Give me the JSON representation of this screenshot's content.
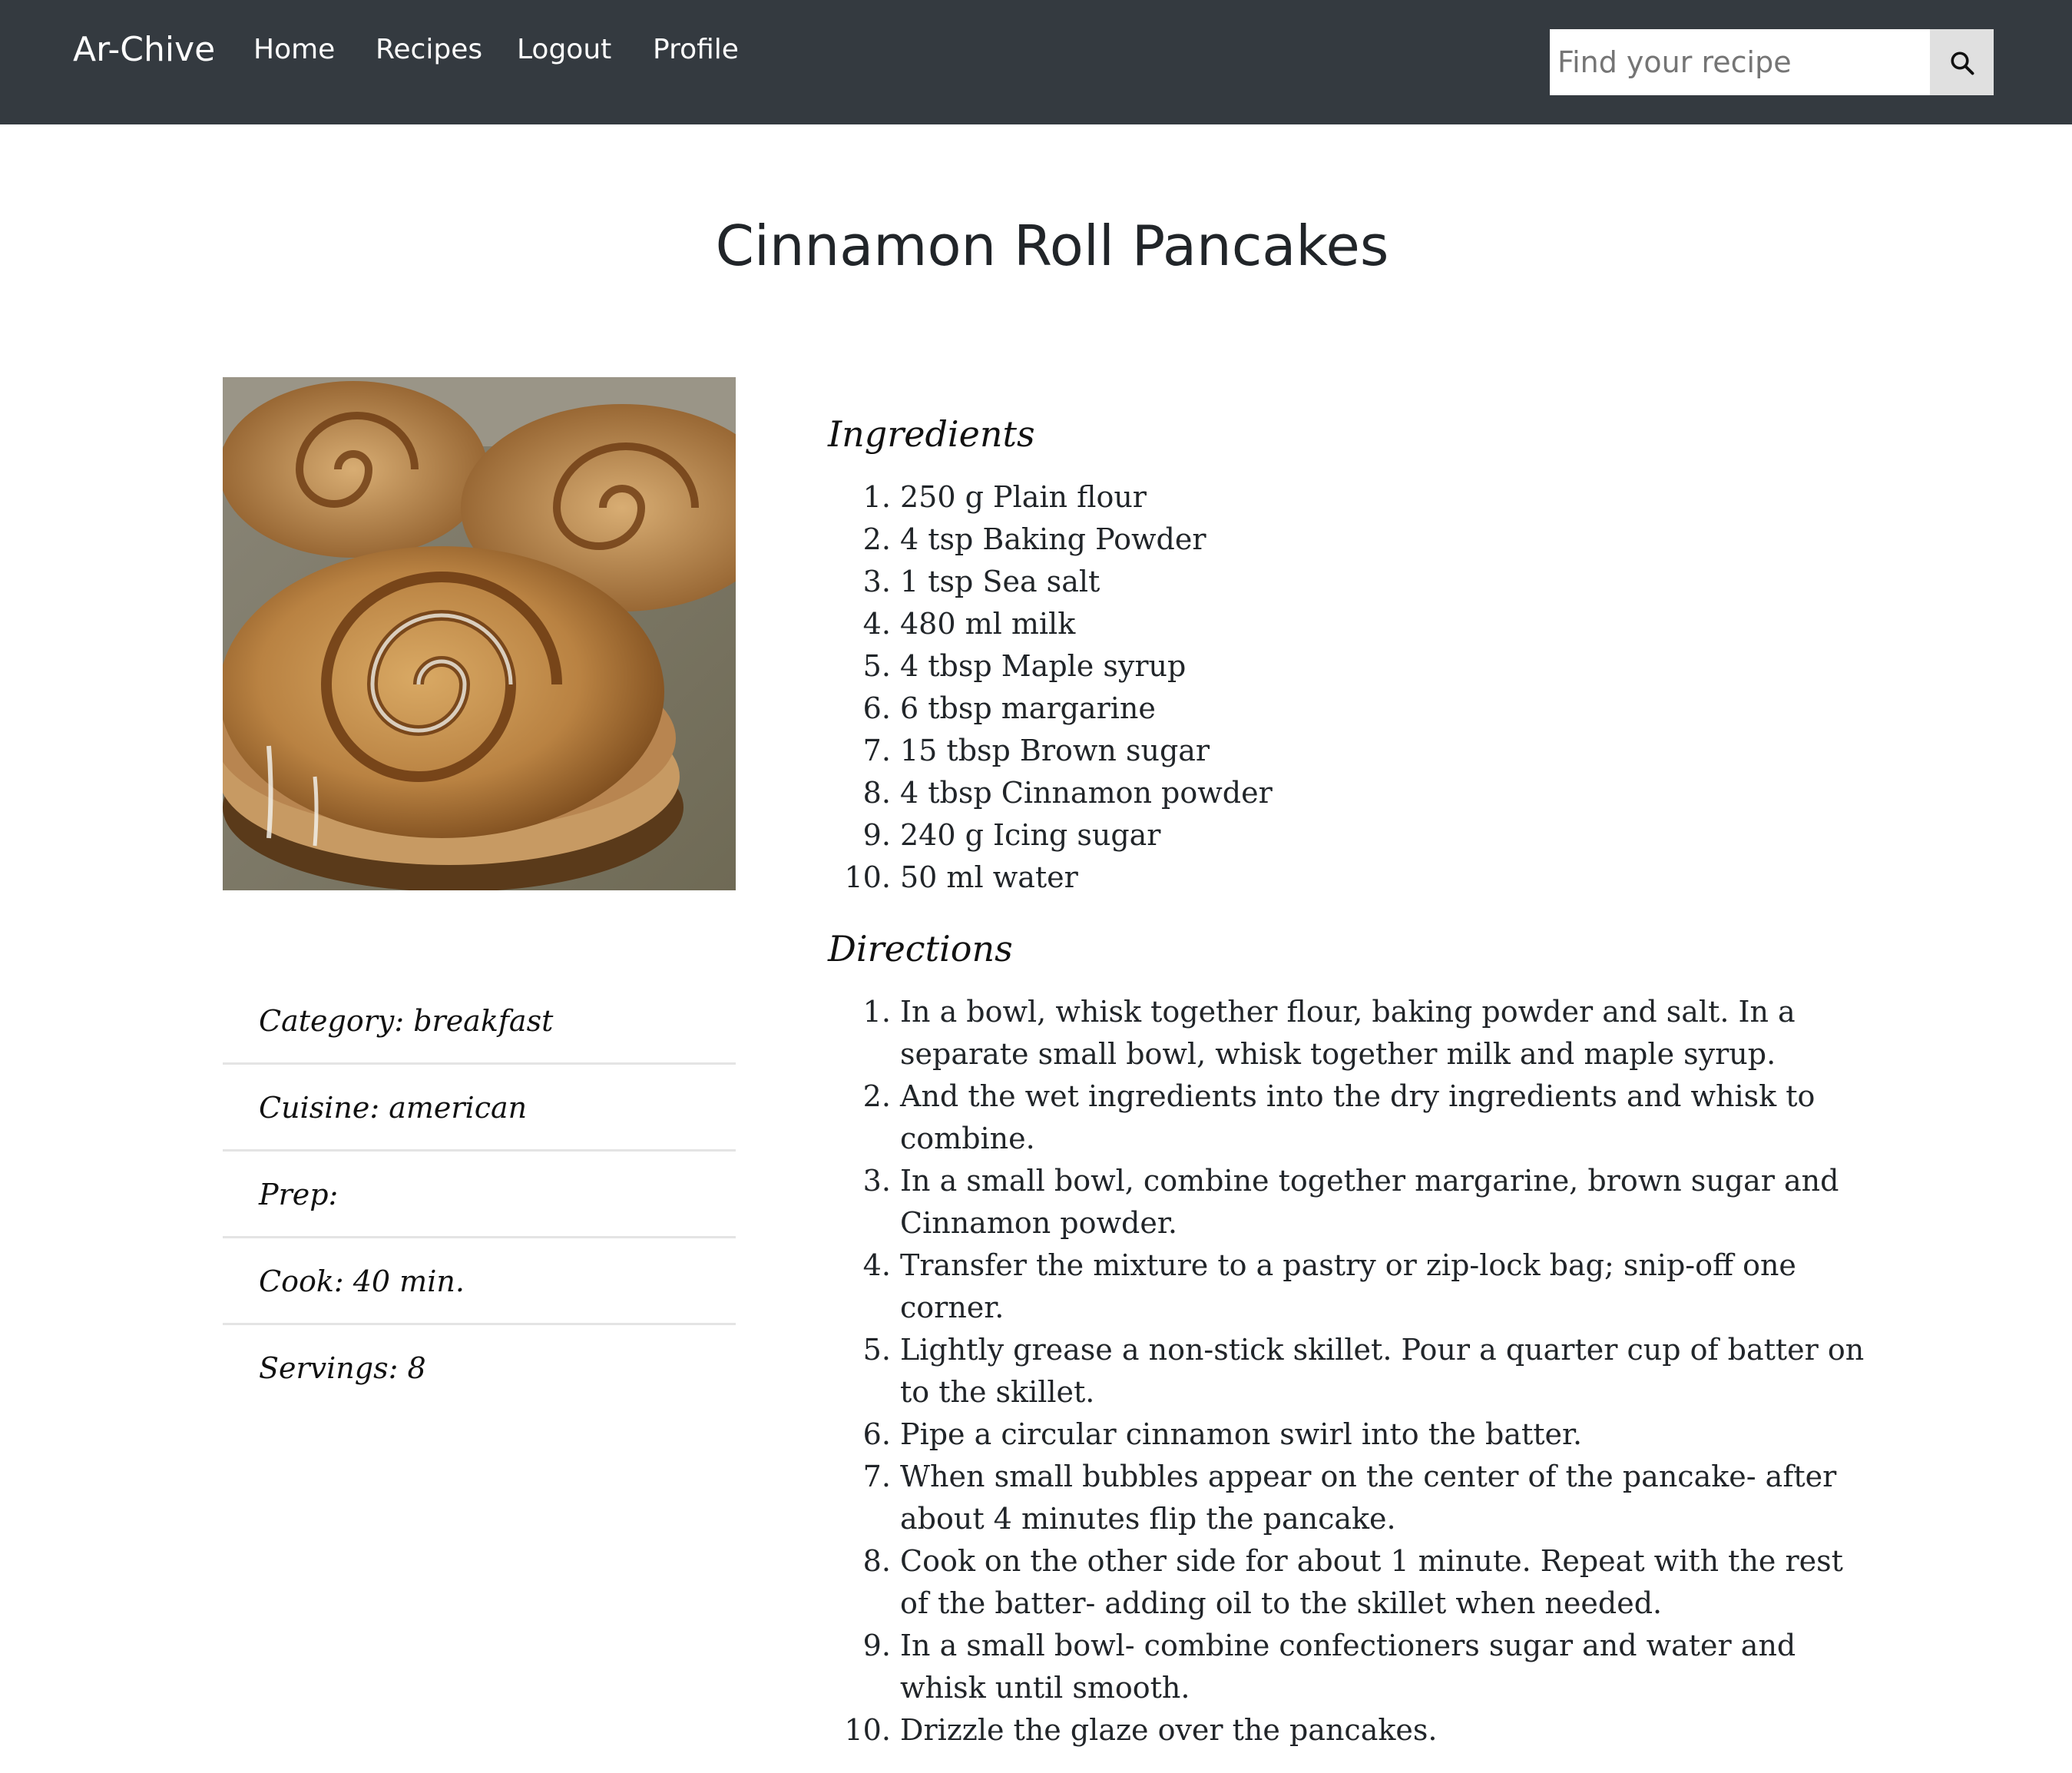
{
  "navbar": {
    "brand": "Ar-Chive",
    "links": [
      "Home",
      "Recipes",
      "Logout",
      "Profile"
    ],
    "search_placeholder": "Find your recipe",
    "search_icon": "search-icon",
    "background_color": "#343a40"
  },
  "recipe": {
    "title": "Cinnamon Roll Pancakes",
    "image_alt": "cinnamon roll pancakes photo",
    "info": {
      "category": "Category: breakfast",
      "cuisine": "Cuisine: american",
      "prep": "Prep:",
      "cook": "Cook: 40 min.",
      "servings": "Servings: 8"
    },
    "ingredients_heading": "Ingredients",
    "ingredients": [
      "250 g Plain flour",
      "4 tsp Baking Powder",
      "1 tsp Sea salt",
      "480 ml milk",
      "4 tbsp Maple syrup",
      "6 tbsp margarine",
      "15 tbsp Brown sugar",
      "4 tbsp Cinnamon powder",
      "240 g Icing sugar",
      "50 ml water"
    ],
    "directions_heading": "Directions",
    "directions": [
      "In a bowl, whisk together flour, baking powder and salt. In a separate small bowl, whisk together milk and maple syrup.",
      "And the wet ingredients into the dry ingredients and whisk to combine.",
      "In a small bowl, combine together margarine, brown sugar and Cinnamon powder.",
      "Transfer the mixture to a pastry or zip-lock bag; snip-off one corner.",
      "Lightly grease a non-stick skillet. Pour a quarter cup of batter on to the skillet.",
      "Pipe a circular cinnamon swirl into the batter.",
      "When small bubbles appear on the center of the pancake- after about 4 minutes flip the pancake.",
      "Cook on the other side for about 1 minute. Repeat with the rest of the batter- adding oil to the skillet when needed.",
      "In a small bowl- combine confectioners sugar and water and whisk until smooth.",
      "Drizzle the glaze over the pancakes."
    ]
  }
}
